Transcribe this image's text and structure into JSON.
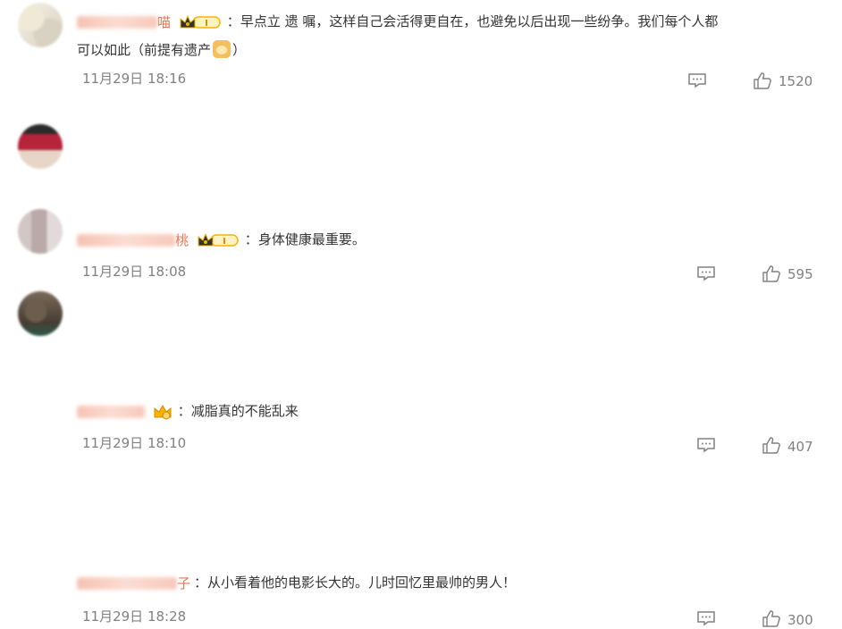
{
  "comments": [
    {
      "username_tail": "喵",
      "text_line1": "早点立 遗 嘱，这样自己会活得更自在，也避免以后出现一些纷争。我们每个人都",
      "text_line2": "可以如此（前提有遗产",
      "text_line2_end": "）",
      "emoji_icon": "dog-face-icon",
      "timestamp": "11月29日 18:16",
      "likes": "1520",
      "badge_icon": "crown-vip-badge-icon"
    },
    {
      "username_tail": "桃",
      "text_line1": "身体健康最重要。",
      "timestamp": "11月29日 18:08",
      "likes": "595",
      "badge_icon": "crown-vip-badge-icon"
    },
    {
      "username_tail": "",
      "text_line1": "减脂真的不能乱来",
      "timestamp": "11月29日 18:10",
      "likes": "407",
      "badge_icon": "small-crown-badge-icon"
    },
    {
      "username_tail": "子",
      "text_line1": "从小看着他的电影长大的。儿时回忆里最帅的男人！",
      "timestamp": "11月29日 18:28",
      "likes": "300",
      "badge_icon": ""
    }
  ],
  "colon": "：",
  "colors": {
    "username": "#eb7350",
    "text": "#333333",
    "meta": "#808080",
    "badge_gold": "#f5b400"
  },
  "icons": [
    "reply-icon",
    "like-thumb-icon"
  ]
}
